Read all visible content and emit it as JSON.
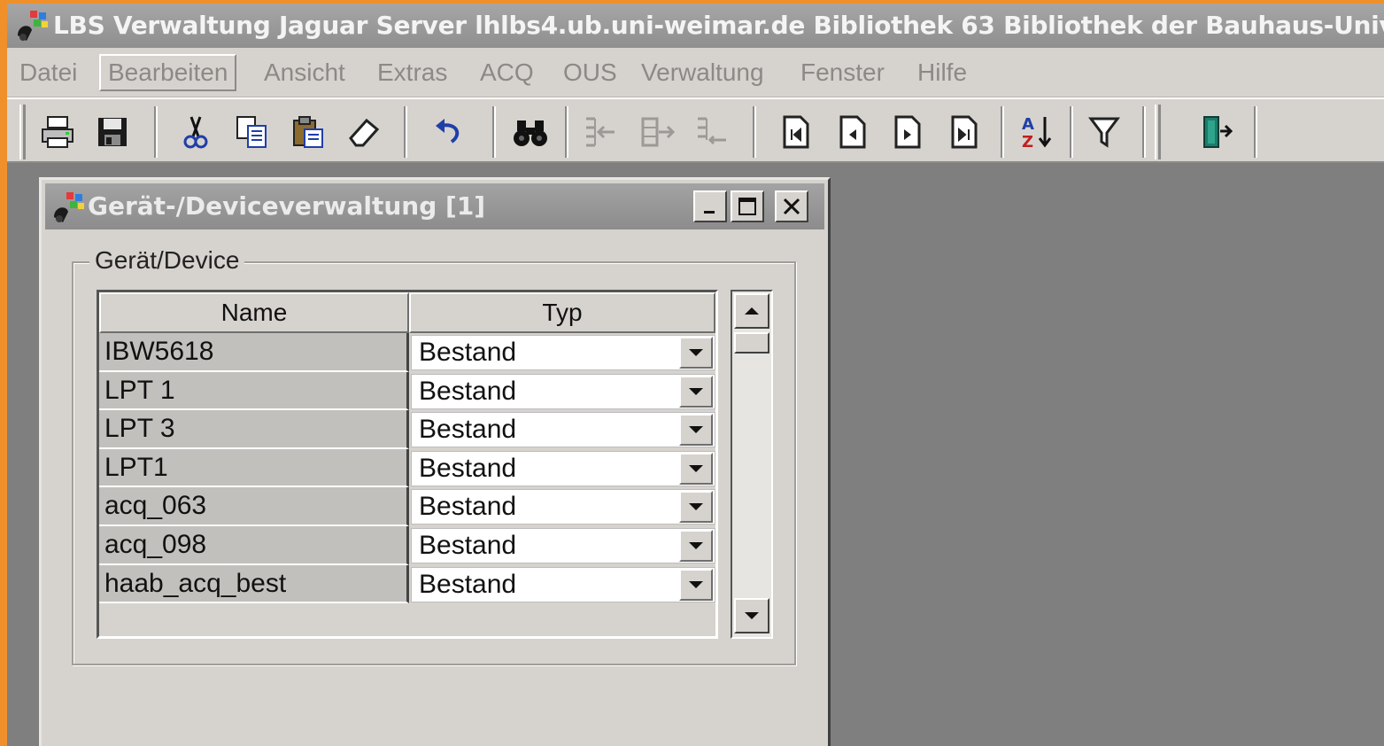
{
  "window": {
    "title": "LBS Verwaltung Jaguar Server lhlbs4.ub.uni-weimar.de  Bibliothek 63 Bibliothek der Bauhaus-Unive"
  },
  "menu": [
    {
      "label": "Datei"
    },
    {
      "label": "Bearbeiten",
      "active": true
    },
    {
      "label": "Ansicht"
    },
    {
      "label": "Extras"
    },
    {
      "label": "ACQ"
    },
    {
      "label": "OUS"
    },
    {
      "label": "Verwaltung"
    },
    {
      "label": "Fenster"
    },
    {
      "label": "Hilfe"
    }
  ],
  "toolbar": [
    {
      "name": "print-button",
      "icon": "printer-icon"
    },
    {
      "name": "save-button",
      "icon": "floppy-disk-icon"
    },
    {
      "name": "cut-button",
      "icon": "scissors-icon"
    },
    {
      "name": "copy-button",
      "icon": "copy-icon"
    },
    {
      "name": "paste-button",
      "icon": "clipboard-icon"
    },
    {
      "name": "erase-button",
      "icon": "eraser-icon"
    },
    {
      "name": "undo-button",
      "icon": "undo-icon"
    },
    {
      "name": "find-button",
      "icon": "binoculars-icon"
    },
    {
      "name": "record-insert-button",
      "icon": "insert-record-icon",
      "disabled": true
    },
    {
      "name": "record-append-button",
      "icon": "append-record-icon",
      "disabled": true
    },
    {
      "name": "record-delete-button",
      "icon": "delete-record-icon",
      "disabled": true
    },
    {
      "name": "first-record-button",
      "icon": "first-page-icon"
    },
    {
      "name": "previous-record-button",
      "icon": "previous-page-icon"
    },
    {
      "name": "next-record-button",
      "icon": "next-page-icon"
    },
    {
      "name": "last-record-button",
      "icon": "last-page-icon"
    },
    {
      "name": "sort-button",
      "icon": "sort-az-icon"
    },
    {
      "name": "filter-button",
      "icon": "funnel-icon"
    },
    {
      "name": "exit-button",
      "icon": "exit-door-icon"
    }
  ],
  "child_window": {
    "title": "Gerät-/Deviceverwaltung [1]",
    "group_label": "Gerät/Device",
    "columns": [
      "Name",
      "Typ"
    ],
    "rows": [
      {
        "name": "IBW5618",
        "typ": "Bestand"
      },
      {
        "name": "LPT 1",
        "typ": "Bestand"
      },
      {
        "name": "LPT 3",
        "typ": "Bestand"
      },
      {
        "name": "LPT1",
        "typ": "Bestand"
      },
      {
        "name": "acq_063",
        "typ": "Bestand"
      },
      {
        "name": "acq_098",
        "typ": "Bestand"
      },
      {
        "name": "haab_acq_best",
        "typ": "Bestand"
      }
    ]
  },
  "colors": {
    "desktop": "#7f7f7f",
    "border_orange": "#f0902a",
    "face": "#d6d3ce",
    "titlebar_inactive": "#9a9a9a"
  }
}
